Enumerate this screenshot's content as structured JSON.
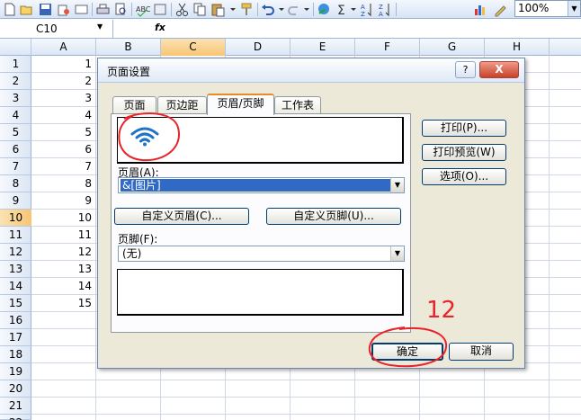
{
  "toolbar": {
    "zoom": "100%"
  },
  "formula_bar": {
    "cell_ref": "C10",
    "fx": "fx"
  },
  "grid": {
    "columns": [
      "A",
      "B",
      "C",
      "D",
      "E",
      "F",
      "G",
      "H"
    ],
    "rows": [
      "1",
      "2",
      "3",
      "4",
      "5",
      "6",
      "7",
      "8",
      "9",
      "10",
      "11",
      "12",
      "13",
      "14",
      "15",
      "16",
      "17",
      "18",
      "19",
      "20",
      "21",
      "22"
    ],
    "col_a_values": [
      "1",
      "2",
      "3",
      "4",
      "5",
      "6",
      "7",
      "8",
      "9",
      "10",
      "11",
      "12",
      "13",
      "14",
      "15"
    ]
  },
  "dialog": {
    "title": "页面设置",
    "help": "?",
    "close": "X",
    "tabs": [
      "页面",
      "页边距",
      "页眉/页脚",
      "工作表"
    ],
    "header_label": "页眉(A):",
    "header_value": "&[图片]",
    "custom_header": "自定义页眉(C)...",
    "custom_footer": "自定义页脚(U)...",
    "footer_label": "页脚(F):",
    "footer_value": "(无)",
    "print": "打印(P)...",
    "print_preview": "打印预览(W)",
    "options": "选项(O)...",
    "ok": "确定",
    "cancel": "取消"
  },
  "annotation": {
    "number": "12",
    "color": "#e8232a"
  },
  "colors": {
    "selection_header": "#f7c574",
    "wifi_icon": "#1f73c6",
    "combo_highlight": "#316ac5"
  }
}
